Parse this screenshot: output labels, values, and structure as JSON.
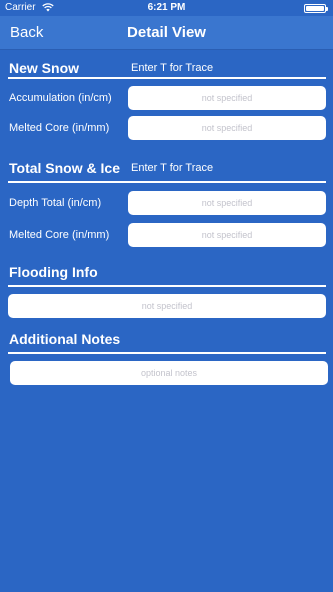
{
  "status_bar": {
    "carrier": "Carrier",
    "time": "6:21 PM",
    "wifi_icon": "wifi-icon",
    "battery_icon": "battery-icon"
  },
  "nav": {
    "back_label": "Back",
    "title": "Detail View"
  },
  "new_snow": {
    "header": "New Snow",
    "hint": "Enter T for Trace",
    "fields": [
      {
        "label": "Accumulation (in/cm)",
        "placeholder": "not specified",
        "value": ""
      },
      {
        "label": "Melted Core (in/mm)",
        "placeholder": "not specified",
        "value": ""
      }
    ]
  },
  "total_snow_ice": {
    "header": "Total Snow & Ice",
    "hint": "Enter T for Trace",
    "fields": [
      {
        "label": "Depth Total (in/cm)",
        "placeholder": "not specified",
        "value": ""
      },
      {
        "label": "Melted Core (in/mm)",
        "placeholder": "not specified",
        "value": ""
      }
    ]
  },
  "flooding": {
    "header": "Flooding Info",
    "placeholder": "not specified",
    "value": ""
  },
  "notes": {
    "header": "Additional Notes",
    "placeholder": "optional notes",
    "value": ""
  },
  "colors": {
    "background": "#2b66c4",
    "nav_bar": "#3a76cf",
    "text": "#ffffff",
    "placeholder": "#c3c3cc"
  }
}
